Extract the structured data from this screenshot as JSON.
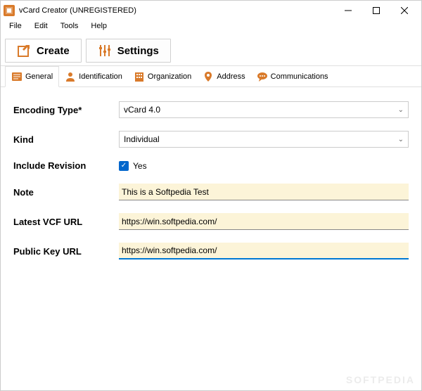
{
  "window": {
    "title": "vCard Creator (UNREGISTERED)"
  },
  "menubar": {
    "items": [
      "File",
      "Edit",
      "Tools",
      "Help"
    ]
  },
  "toolbar": {
    "create_label": "Create",
    "settings_label": "Settings"
  },
  "tabs": {
    "items": [
      {
        "label": "General"
      },
      {
        "label": "Identification"
      },
      {
        "label": "Organization"
      },
      {
        "label": "Address"
      },
      {
        "label": "Communications"
      }
    ],
    "active_index": 0
  },
  "form": {
    "encoding_type": {
      "label": "Encoding Type*",
      "value": "vCard 4.0"
    },
    "kind": {
      "label": "Kind",
      "value": "Individual"
    },
    "include_revision": {
      "label": "Include Revision",
      "checkbox_label": "Yes",
      "checked": true
    },
    "note": {
      "label": "Note",
      "value": "This is a Softpedia Test"
    },
    "latest_vcf_url": {
      "label": "Latest VCF URL",
      "value": "https://win.softpedia.com/"
    },
    "public_key_url": {
      "label": "Public Key URL",
      "value": "https://win.softpedia.com/"
    }
  },
  "colors": {
    "accent_orange": "#d97a2a",
    "input_bg": "#fcf4d8",
    "focus_blue": "#0078d4",
    "checkbox_blue": "#0066cc"
  },
  "watermark": "SOFTPEDIA"
}
